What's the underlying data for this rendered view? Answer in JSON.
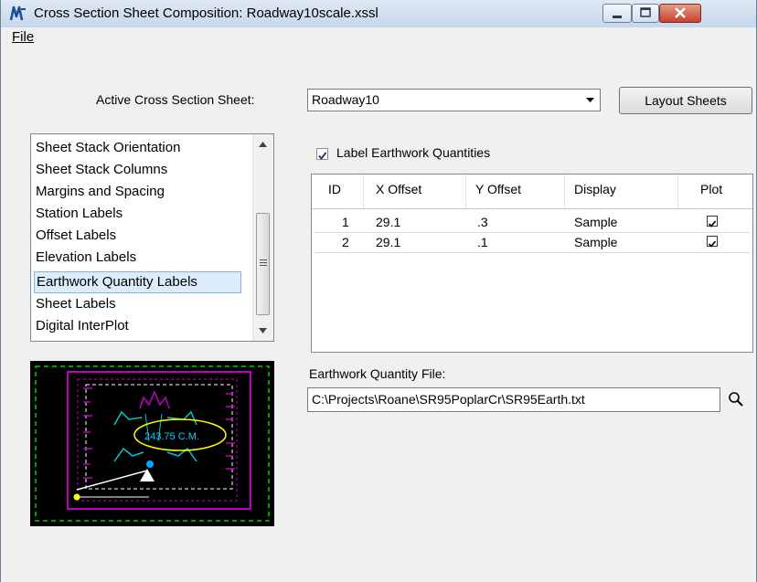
{
  "window": {
    "title": "Cross Section Sheet Composition: Roadway10scale.xssl"
  },
  "menu": {
    "file": "File"
  },
  "active_sheet": {
    "label": "Active Cross Section Sheet:",
    "value": "Roadway10",
    "layout_button": "Layout Sheets"
  },
  "categories": [
    "Sheet Stack Orientation",
    "Sheet Stack Columns",
    "Margins and Spacing",
    "Station Labels",
    "Offset Labels",
    "Elevation Labels",
    "Earthwork Quantity Labels",
    "Sheet Labels",
    "Digital InterPlot"
  ],
  "selected_category": "Earthwork Quantity Labels",
  "preview": {
    "label_text": "243.75 C.M."
  },
  "label_earthwork": {
    "label": "Label Earthwork Quantities",
    "checked": true
  },
  "table": {
    "headers": [
      "ID",
      "X Offset",
      "Y Offset",
      "Display",
      "Plot"
    ],
    "rows": [
      {
        "id": "1",
        "x_offset": "29.1",
        "y_offset": ".3",
        "display": "Sample",
        "plot": true
      },
      {
        "id": "2",
        "x_offset": "29.1",
        "y_offset": ".1",
        "display": "Sample",
        "plot": true
      }
    ]
  },
  "earthwork_file": {
    "label": "Earthwork Quantity File:",
    "value": "C:\\Projects\\Roane\\SR95PoplarCr\\SR95Earth.txt"
  },
  "colors": {
    "title_gradient_top": "#dfe9f5",
    "close_button": "#c6422b",
    "selection": "#ddecfb",
    "preview_bg": "#000000"
  }
}
